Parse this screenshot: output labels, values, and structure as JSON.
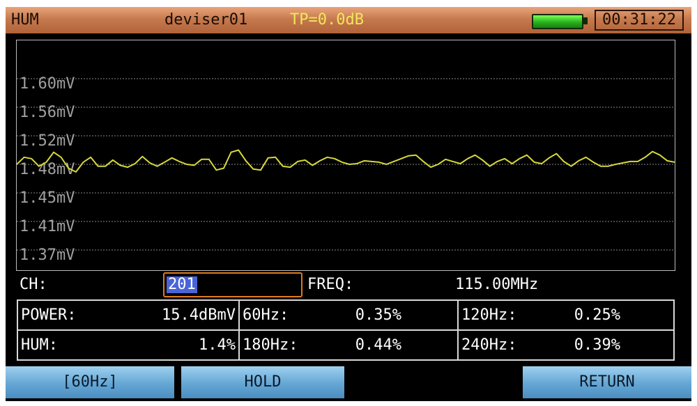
{
  "top_bar": {
    "mode": "HUM",
    "device": "deviser01",
    "tp_level": "TP=0.0dB",
    "clock": "00:31:22"
  },
  "colors": {
    "header": "#c67a4e",
    "trace": "#d8d83a",
    "softkey": "#64a6d4",
    "cursor": "#e07a20"
  },
  "graph": {
    "y_labels": [
      "1.60mV",
      "1.56mV",
      "1.52mV",
      "1.48mV",
      "1.45mV",
      "1.41mV",
      "1.37mV"
    ],
    "trace": [
      1.48,
      1.49,
      1.488,
      1.478,
      1.483,
      1.497,
      1.49,
      1.476,
      1.472,
      1.483,
      1.49,
      1.478,
      1.478,
      1.486,
      1.479,
      1.477,
      1.481,
      1.491,
      1.482,
      1.478,
      1.483,
      1.489,
      1.484,
      1.48,
      1.479,
      1.487,
      1.487,
      1.474,
      1.476,
      1.497,
      1.5,
      1.485,
      1.475,
      1.474,
      1.489,
      1.49,
      1.478,
      1.477,
      1.484,
      1.486,
      1.479,
      1.485,
      1.49,
      1.488,
      1.483,
      1.48,
      1.481,
      1.485,
      1.484,
      1.483,
      1.48,
      1.484,
      1.488,
      1.492,
      1.493,
      1.484,
      1.477,
      1.48,
      1.487,
      1.484,
      1.481,
      1.488,
      1.493,
      1.486,
      1.478,
      1.484,
      1.488,
      1.481,
      1.488,
      1.493,
      1.483,
      1.481,
      1.489,
      1.495,
      1.484,
      1.478,
      1.485,
      1.49,
      1.483,
      1.478,
      1.478,
      1.48,
      1.482,
      1.484,
      1.484,
      1.49,
      1.498,
      1.493,
      1.485,
      1.483
    ]
  },
  "channel": {
    "label": "CH:",
    "value": "201",
    "freq_label": "FREQ:",
    "freq_value": "115.00MHz"
  },
  "measurements": {
    "rows": [
      [
        {
          "label": "POWER:",
          "value": "15.4dBmV"
        },
        {
          "label": "60Hz:",
          "value": "0.35%"
        },
        {
          "label": "120Hz:",
          "value": "0.25%"
        }
      ],
      [
        {
          "label": "HUM:",
          "value": "1.4%"
        },
        {
          "label": "180Hz:",
          "value": "0.44%"
        },
        {
          "label": "240Hz:",
          "value": "0.39%"
        }
      ]
    ]
  },
  "softkeys": [
    "[60Hz]",
    "HOLD",
    "",
    "RETURN"
  ]
}
